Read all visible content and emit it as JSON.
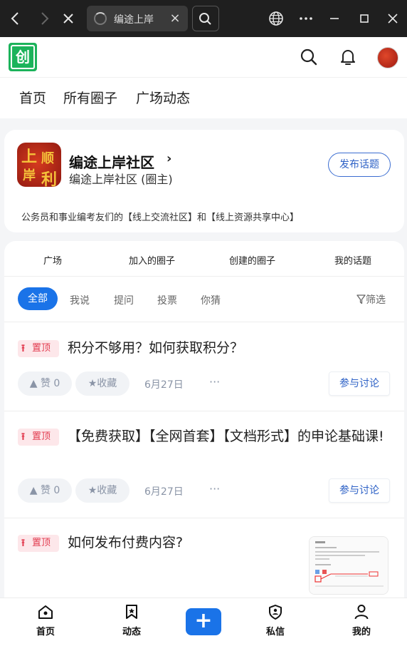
{
  "browser": {
    "back_label": "back",
    "tab_title": "编途上岸",
    "icons": [
      "back-icon",
      "forward-icon",
      "close-icon",
      "search-icon",
      "globe-icon",
      "more-icon",
      "minimize-icon",
      "maximize-icon",
      "window-close-icon"
    ]
  },
  "header": {
    "logo_text": "创",
    "nav": [
      "首页",
      "所有圈子",
      "广场动态"
    ]
  },
  "community": {
    "avatar_chars": [
      "上",
      "顺",
      "岸",
      "利"
    ],
    "name": "编途上岸社区",
    "chevron": "›",
    "subtitle": "编途上岸社区 (圈主)",
    "post_topic_label": "发布话题",
    "description": "公务员和事业编考友们的【线上交流社区】和【线上资源共享中心】"
  },
  "sections": {
    "tabs": [
      "广场",
      "加入的圈子",
      "创建的圈子",
      "我的话题"
    ],
    "filters": [
      "全部",
      "我说",
      "提问",
      "投票",
      "你猜"
    ],
    "filter_button": "筛选"
  },
  "posts": [
    {
      "badge": "置顶",
      "title": "积分不够用？如何获取积分？",
      "like_label": "赞 0",
      "fav_label": "收藏",
      "date": "6月27日",
      "more": "···",
      "join_label": "参与讨论"
    },
    {
      "badge": "置顶",
      "title": "【免费获取】【全网首套】【文档形式】的申论基础课!",
      "like_label": "赞 0",
      "fav_label": "收藏",
      "date": "6月27日",
      "more": "···",
      "join_label": "参与讨论"
    },
    {
      "badge": "置顶",
      "title": "如何发布付费内容?"
    }
  ],
  "bottom_nav": {
    "items": [
      "首页",
      "动态",
      "私信",
      "我的"
    ],
    "plus": "+"
  },
  "colors": {
    "accent": "#1a73e8",
    "brand_green": "#1cb35b",
    "pin_red": "#e23b4f",
    "link_blue": "#2d61c6"
  }
}
